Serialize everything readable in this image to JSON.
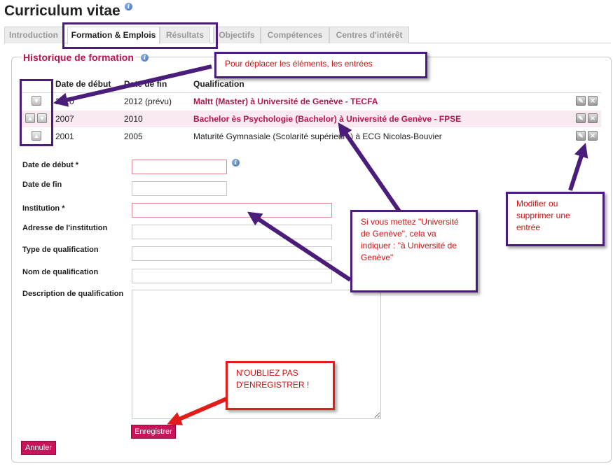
{
  "page": {
    "title": "Curriculum vitae"
  },
  "tabs": [
    {
      "label": "Introduction"
    },
    {
      "label": "Formation & Emplois",
      "active": true
    },
    {
      "label": "Résultats"
    },
    {
      "label": "Objectifs"
    },
    {
      "label": "Compétences"
    },
    {
      "label": "Centres d'intérêt"
    }
  ],
  "section": {
    "legend": "Historique de formation"
  },
  "table": {
    "headers": [
      "Date de début",
      "Date de fin",
      "Qualification"
    ],
    "rows": [
      {
        "start": "2010",
        "end": "2012 (prévu)",
        "qualification": "Maltt (Master) à Université de Genève - TECFA"
      },
      {
        "start": "2007",
        "end": "2010",
        "qualification": "Bachelor ès Psychologie (Bachelor) à Université de Genève - FPSE"
      },
      {
        "start": "2001",
        "end": "2005",
        "qualification": "Maturité Gymnasiale (Scolarité supérieure) à ECG Nicolas-Bouvier"
      }
    ]
  },
  "form": {
    "start_label": "Date de début *",
    "end_label": "Date de fin",
    "institution_label": "Institution *",
    "address_label": "Adresse de l'institution",
    "type_label": "Type de qualification",
    "name_label": "Nom de qualification",
    "description_label": "Description de qualification",
    "start_value": "",
    "end_value": "",
    "institution_value": "",
    "address_value": "",
    "type_value": "",
    "name_value": "",
    "description_value": "",
    "save_label": "Enregistrer",
    "cancel_label": "Annuler"
  },
  "annotations": {
    "move": "Pour déplacer les éléments, les entrées",
    "institution": "Si vous mettez \"Université de Genève\", cela va indiquer : \"à Université de Genève\"",
    "edit": "Modifier ou supprimer une entrée",
    "save": "N'OUBLIEZ PAS D'ENREGISTRER !"
  },
  "colors": {
    "accent": "#b5164f",
    "button": "#c8135a",
    "callout_border": "#4b1d7a",
    "alert": "#e21b1b"
  }
}
